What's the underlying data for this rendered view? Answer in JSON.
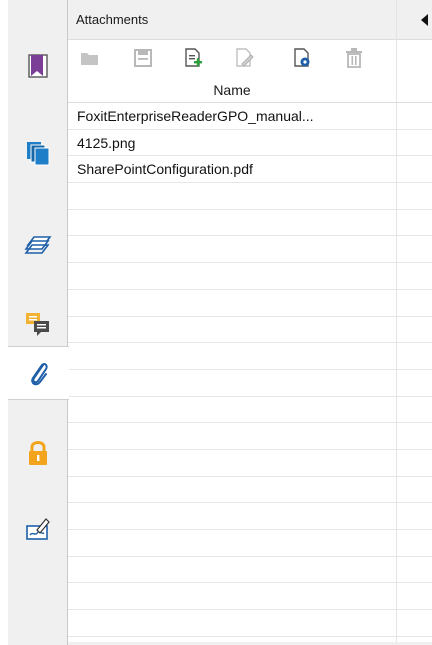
{
  "panel": {
    "title": "Attachments"
  },
  "toolbar": {
    "buttons": [
      {
        "name": "open-attachment-button",
        "icon": "folder-icon"
      },
      {
        "name": "save-attachment-button",
        "icon": "save-icon"
      },
      {
        "name": "add-attachment-button",
        "icon": "add-file-icon"
      },
      {
        "name": "edit-description-button",
        "icon": "edit-icon"
      },
      {
        "name": "attachment-properties-button",
        "icon": "gear-file-icon"
      },
      {
        "name": "delete-attachment-button",
        "icon": "trash-icon"
      }
    ]
  },
  "table": {
    "column_header": "Name",
    "rows": [
      {
        "name": "FoxitEnterpriseReaderGPO_manual..."
      },
      {
        "name": "4125.png"
      },
      {
        "name": "SharePointConfiguration.pdf"
      },
      {
        "name": ""
      },
      {
        "name": ""
      },
      {
        "name": ""
      },
      {
        "name": ""
      },
      {
        "name": ""
      },
      {
        "name": ""
      },
      {
        "name": ""
      },
      {
        "name": ""
      },
      {
        "name": ""
      },
      {
        "name": ""
      },
      {
        "name": ""
      },
      {
        "name": ""
      },
      {
        "name": ""
      },
      {
        "name": ""
      },
      {
        "name": ""
      },
      {
        "name": ""
      },
      {
        "name": ""
      }
    ]
  },
  "side_rail": {
    "items": [
      {
        "name": "bookmarks",
        "icon": "bookmark-icon"
      },
      {
        "name": "pages",
        "icon": "pages-icon"
      },
      {
        "name": "layers",
        "icon": "layers-icon"
      },
      {
        "name": "comments",
        "icon": "comment-icon"
      },
      {
        "name": "attachments",
        "icon": "paperclip-icon",
        "active": true
      },
      {
        "name": "security",
        "icon": "lock-icon"
      },
      {
        "name": "signatures",
        "icon": "signature-icon"
      }
    ]
  },
  "colors": {
    "bookmark": "#7b3f98",
    "pages": "#1e7ec8",
    "comment": "#f2b233",
    "lock": "#f2a51c",
    "toolbar_disabled": "#b8b8b8",
    "toolbar_green": "#2e9e3a"
  }
}
